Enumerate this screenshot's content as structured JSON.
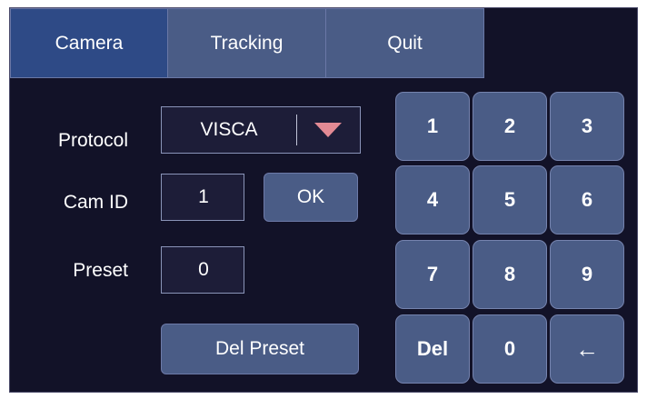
{
  "tabs": [
    {
      "label": "Camera",
      "active": true
    },
    {
      "label": "Tracking",
      "active": false
    },
    {
      "label": "Quit",
      "active": false
    }
  ],
  "form": {
    "protocol_label": "Protocol",
    "protocol_value": "VISCA",
    "camid_label": "Cam ID",
    "camid_value": "1",
    "ok_label": "OK",
    "preset_label": "Preset",
    "preset_value": "0",
    "del_preset_label": "Del Preset"
  },
  "keypad": {
    "k1": "1",
    "k2": "2",
    "k3": "3",
    "k4": "4",
    "k5": "5",
    "k6": "6",
    "k7": "7",
    "k8": "8",
    "k9": "9",
    "del": "Del",
    "k0": "0",
    "back": "←"
  },
  "colors": {
    "background": "#121228",
    "tab_active": "#2e4a86",
    "button": "#4a5c86",
    "dropdown_arrow": "#e28a94"
  }
}
